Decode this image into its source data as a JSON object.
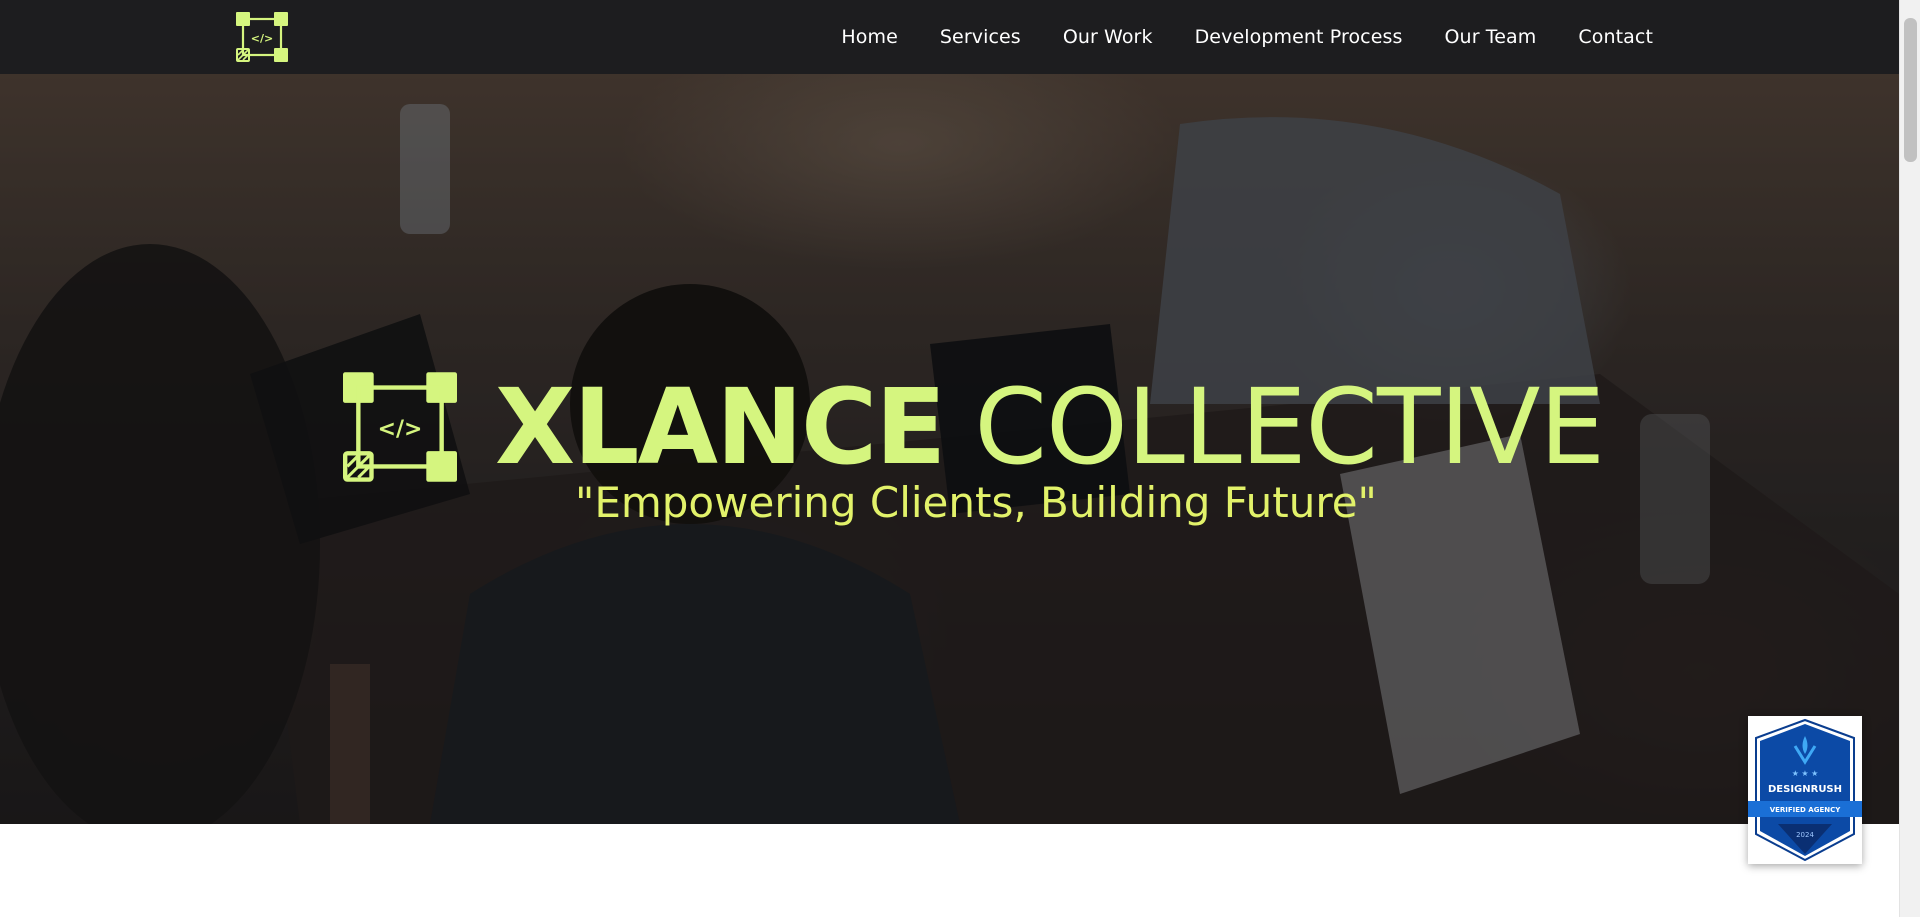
{
  "nav": {
    "logo_icon": "code-grid-logo-icon",
    "items": [
      {
        "label": "Home"
      },
      {
        "label": "Services"
      },
      {
        "label": "Our Work"
      },
      {
        "label": "Development Process"
      },
      {
        "label": "Our Team"
      },
      {
        "label": "Contact"
      }
    ]
  },
  "hero": {
    "brand_bold": "XLANCE",
    "brand_light": "COLLECTIVE",
    "tagline": "\"Empowering Clients, Building Future\"",
    "logo_glyph": "</>",
    "background_image": "team-working-on-laptops-photo"
  },
  "badge": {
    "title": "DESIGNRUSH",
    "ribbon": "VERIFIED AGENCY",
    "year": "2024"
  },
  "intro": {
    "text": ""
  },
  "colors": {
    "accent": "#d5f57f",
    "tagline": "#e2f26a",
    "navbar": "#1d1d1f",
    "badge_blue": "#0a3d8f"
  }
}
